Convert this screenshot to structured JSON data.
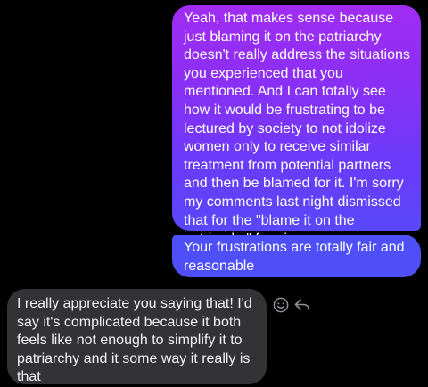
{
  "thread": {
    "messages": [
      {
        "direction": "sent",
        "text": "Yeah, that makes sense because just blaming it on the patriarchy doesn't really address the situations you experienced that you mentioned. And I can totally see how it would be frustrating to be lectured by society to not idolize women only to receive similar treatment from potential partners and then be blamed for it. I'm sorry my comments last night dismissed that for the \"blame it on the patriarchy\" framing"
      },
      {
        "direction": "sent",
        "text": "Your frustrations are totally fair and reasonable"
      },
      {
        "direction": "received",
        "text": "I really appreciate you saying that! I'd say it's complicated because it both feels like not enough to simplify it to patriarchy and it some way it really is that"
      }
    ],
    "actions": {
      "react_icon": "smiley-face-icon",
      "reply_icon": "reply-arrow-icon"
    }
  },
  "colors": {
    "background": "#000000",
    "sent_gradient_top": "#a12cf2",
    "sent_gradient_bottom": "#5848fb",
    "sent_second": "#4e4ff8",
    "received": "#333336",
    "icon": "#8e8e93"
  }
}
